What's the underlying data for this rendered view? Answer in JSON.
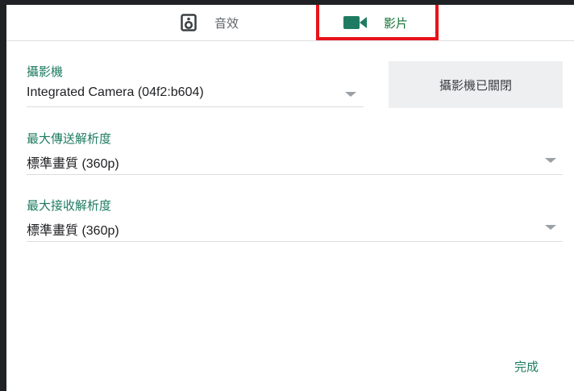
{
  "tabs": {
    "audio_label": "音效",
    "video_label": "影片"
  },
  "camera": {
    "label": "攝影機",
    "value": "Integrated Camera (04f2:b604)"
  },
  "preview": {
    "status_text": "攝影機已關閉"
  },
  "send_resolution": {
    "label": "最大傳送解析度",
    "value": "標準畫質 (360p)"
  },
  "receive_resolution": {
    "label": "最大接收解析度",
    "value": "標準畫質 (360p)"
  },
  "footer": {
    "done_label": "完成"
  },
  "colors": {
    "accent": "#1e7b61",
    "highlight": "#e8131a"
  },
  "icons": {
    "audio_tab": "speaker-icon",
    "video_tab": "videocam-icon",
    "dropdown": "caret-down-icon"
  }
}
